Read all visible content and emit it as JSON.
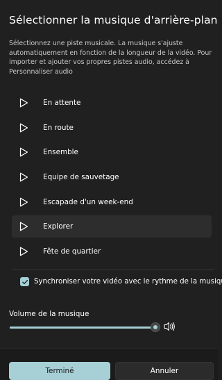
{
  "dialog": {
    "title": "Sélectionner la musique d'arrière-plan",
    "description": "Sélectionnez une piste musicale. La musique s'ajuste automatiquement en fonction de la longueur de la vidéo. Pour importer et ajouter vos propres pistes audio, accédez à Personnaliser audio"
  },
  "tracks": [
    {
      "label": "En attente",
      "icon": "play-icon",
      "selected": false
    },
    {
      "label": "En route",
      "icon": "play-icon",
      "selected": false
    },
    {
      "label": "Ensemble",
      "icon": "play-icon",
      "selected": false
    },
    {
      "label": "Equipe de sauvetage",
      "icon": "play-icon",
      "selected": false
    },
    {
      "label": "Escapade d'un week-end",
      "icon": "play-icon",
      "selected": false
    },
    {
      "label": "Explorer",
      "icon": "play-icon",
      "selected": true
    },
    {
      "label": "Fête de quartier",
      "icon": "play-icon",
      "selected": false
    }
  ],
  "sync": {
    "checked": true,
    "label": "Synchroniser votre vidéo avec le rythme de la musique"
  },
  "volume": {
    "label": "Volume de la musique",
    "value": 1.0,
    "icon": "speaker-volume-icon"
  },
  "footer": {
    "done_label": "Terminé",
    "cancel_label": "Annuler"
  },
  "colors": {
    "accent": "#a6cfd6",
    "background": "#202020",
    "selected_row": "#2d2d2d"
  }
}
